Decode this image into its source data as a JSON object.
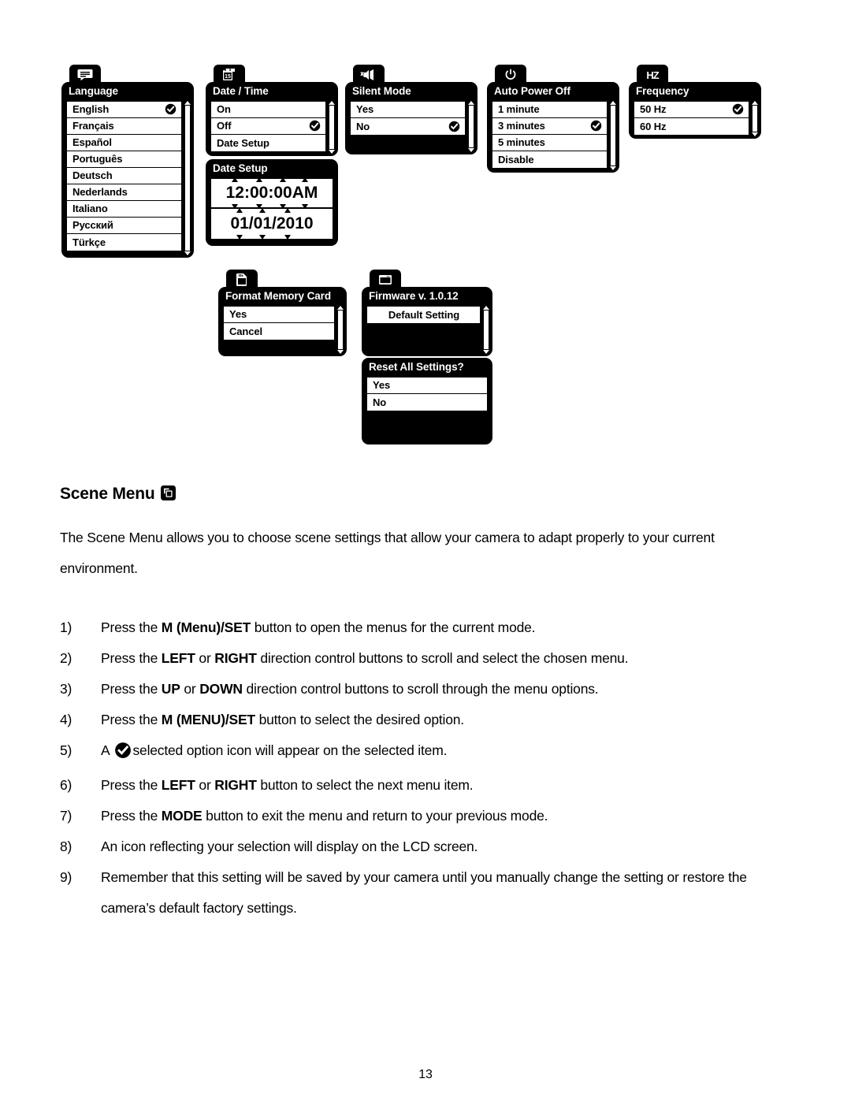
{
  "screens": [
    {
      "id": "language",
      "tab_icon": "speech-bubble-icon",
      "title": "Language",
      "scrollbar": true,
      "rows": [
        {
          "label": "English",
          "checked": true
        },
        {
          "label": "Français",
          "checked": false
        },
        {
          "label": "Español",
          "checked": false
        },
        {
          "label": "Português",
          "checked": false
        },
        {
          "label": "Deutsch",
          "checked": false
        },
        {
          "label": "Nederlands",
          "checked": false
        },
        {
          "label": "Italiano",
          "checked": false
        },
        {
          "label": "Русский",
          "checked": false
        },
        {
          "label": "Türkçe",
          "checked": false
        }
      ]
    },
    {
      "id": "date-time",
      "tab_icon": "calendar-icon",
      "title": "Date / Time",
      "scrollbar": true,
      "rows": [
        {
          "label": "On",
          "checked": false
        },
        {
          "label": "Off",
          "checked": true
        },
        {
          "label": "Date Setup",
          "checked": false
        }
      ]
    },
    {
      "id": "silent-mode",
      "tab_icon": "mute-speaker-icon",
      "title": "Silent Mode",
      "scrollbar": true,
      "rows": [
        {
          "label": "Yes",
          "checked": false
        },
        {
          "label": "No",
          "checked": true
        }
      ]
    },
    {
      "id": "auto-power-off",
      "tab_icon": "power-icon",
      "title": "Auto Power Off",
      "scrollbar": true,
      "rows": [
        {
          "label": "1 minute",
          "checked": false
        },
        {
          "label": "3 minutes",
          "checked": true
        },
        {
          "label": "5 minutes",
          "checked": false
        },
        {
          "label": "Disable",
          "checked": false
        }
      ]
    },
    {
      "id": "frequency",
      "tab_icon": "hz-icon",
      "tab_text": "HZ",
      "title": "Frequency",
      "scrollbar": true,
      "rows": [
        {
          "label": "50 Hz",
          "checked": true
        },
        {
          "label": "60 Hz",
          "checked": false
        }
      ]
    },
    {
      "id": "format-memory-card",
      "tab_icon": "sd-card-icon",
      "title": "Format Memory Card",
      "scrollbar": true,
      "rows": [
        {
          "label": "Yes",
          "checked": false
        },
        {
          "label": "Cancel",
          "checked": false
        }
      ]
    },
    {
      "id": "firmware",
      "tab_icon": "screen-icon",
      "title": "Firmware v. 1.0.12",
      "scrollbar": true,
      "rows": [
        {
          "label": "Default Setting",
          "checked": false,
          "center": true
        }
      ]
    },
    {
      "id": "reset-all-settings",
      "tab_icon": null,
      "title": "Reset All Settings?",
      "scrollbar": false,
      "rows": [
        {
          "label": "Yes",
          "checked": false
        },
        {
          "label": "No",
          "checked": false
        }
      ]
    }
  ],
  "date_setup": {
    "title": "Date Setup",
    "time": {
      "groups": [
        "12",
        "00",
        "00",
        "AM"
      ],
      "separators": [
        ":",
        ":",
        " "
      ],
      "display": "12:00:00 AM"
    },
    "date": {
      "groups": [
        "01",
        "01",
        "2010"
      ],
      "separators": [
        "/",
        "/"
      ],
      "display": "01/01/2010"
    }
  },
  "content": {
    "heading": "Scene Menu",
    "heading_icon": "scene-mode-icon",
    "intro": "The Scene Menu allows you to choose scene settings that allow your camera to adapt properly to your current environment.",
    "steps": [
      {
        "num": "1)",
        "parts": [
          {
            "t": "Press the ",
            "b": false
          },
          {
            "t": "M (Menu)/SET",
            "b": true
          },
          {
            "t": " button to open the menus for the current mode.",
            "b": false
          }
        ]
      },
      {
        "num": "2)",
        "parts": [
          {
            "t": "Press the ",
            "b": false
          },
          {
            "t": "LEFT",
            "b": true
          },
          {
            "t": " or ",
            "b": false
          },
          {
            "t": "RIGHT",
            "b": true
          },
          {
            "t": " direction control buttons to scroll and select the chosen menu.",
            "b": false
          }
        ]
      },
      {
        "num": "3)",
        "parts": [
          {
            "t": "Press the ",
            "b": false
          },
          {
            "t": "UP",
            "b": true
          },
          {
            "t": " or ",
            "b": false
          },
          {
            "t": "DOWN",
            "b": true
          },
          {
            "t": " direction control buttons to scroll through the menu options.",
            "b": false
          }
        ]
      },
      {
        "num": "4)",
        "parts": [
          {
            "t": "Press the ",
            "b": false
          },
          {
            "t": "M (MENU)/SET",
            "b": true
          },
          {
            "t": " button to select the desired option.",
            "b": false
          }
        ]
      },
      {
        "num": "5)",
        "icon_after_index": 0,
        "parts": [
          {
            "t": "A",
            "b": false
          },
          {
            "t": "selected option icon will appear on the selected item.",
            "b": false
          }
        ]
      },
      {
        "num": "6)",
        "parts": [
          {
            "t": "Press the ",
            "b": false
          },
          {
            "t": "LEFT",
            "b": true
          },
          {
            "t": " or ",
            "b": false
          },
          {
            "t": "RIGHT",
            "b": true
          },
          {
            "t": " button to select the next menu item.",
            "b": false
          }
        ]
      },
      {
        "num": "7)",
        "parts": [
          {
            "t": "Press the ",
            "b": false
          },
          {
            "t": "MODE",
            "b": true
          },
          {
            "t": " button to exit the menu and return to your previous mode.",
            "b": false
          }
        ]
      },
      {
        "num": "8)",
        "parts": [
          {
            "t": "An icon reflecting your selection will display on the LCD screen.",
            "b": false
          }
        ]
      },
      {
        "num": "9)",
        "parts": [
          {
            "t": "Remember that this setting will be saved by your camera until you manually change the setting or restore the camera’s default factory settings.",
            "b": false
          }
        ]
      }
    ]
  },
  "page_number": "13",
  "colors": {
    "panel_background": "#000000",
    "row_background": "#ffffff",
    "text": "#000000",
    "page_background": "#ffffff"
  }
}
